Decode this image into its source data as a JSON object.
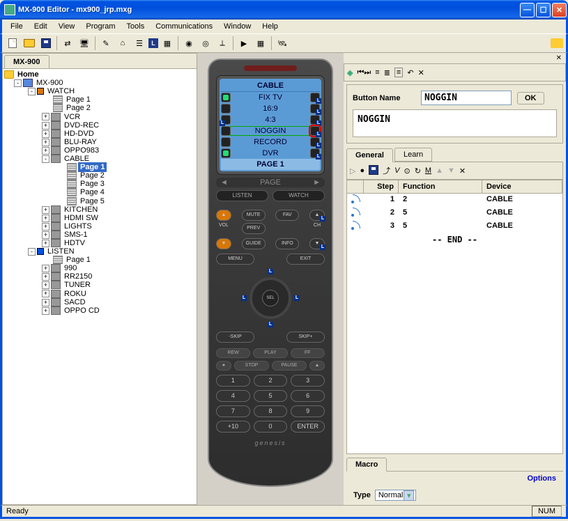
{
  "window": {
    "title": "MX-900 Editor - mx900_jrp.mxg"
  },
  "menu": [
    "File",
    "Edit",
    "View",
    "Program",
    "Tools",
    "Communications",
    "Window",
    "Help"
  ],
  "tree": {
    "tab": "MX-900",
    "root": "Home",
    "device": "MX-900",
    "watch": {
      "label": "WATCH",
      "pages": [
        "Page 1",
        "Page 2"
      ],
      "children": [
        "VCR",
        "DVD-REC",
        "HD-DVD",
        "BLU-RAY",
        "OPPO983"
      ],
      "cable": {
        "label": "CABLE",
        "pages": [
          "Page 1",
          "Page 2",
          "Page 3",
          "Page 4",
          "Page 5"
        ],
        "selected": 0
      },
      "rest": [
        "KITCHEN",
        "HDMI SW",
        "LIGHTS",
        "SMS-1",
        "HDTV"
      ]
    },
    "listen": {
      "label": "LISTEN",
      "pages": [
        "Page 1"
      ],
      "children": [
        "990",
        "RR2150",
        "TUNER",
        "ROKU",
        "SACD",
        "OPPO CD"
      ]
    }
  },
  "remote": {
    "lcd_title": "CABLE",
    "lcd_rows": [
      "FIX TV",
      "16:9",
      "4:3",
      "NOGGIN",
      "RECORD",
      "DVR"
    ],
    "lcd_selected": 3,
    "lcd_footer": "PAGE 1",
    "page_label": "PAGE",
    "listen": "LISTEN",
    "watch": "WATCH",
    "logo": "genesis",
    "nums": [
      "1",
      "2",
      "3",
      "4",
      "5",
      "6",
      "7",
      "8",
      "9",
      "+10",
      "0",
      "ENTER"
    ],
    "hard": {
      "mute": "MUTE",
      "vol": "VOL",
      "ch": "CH",
      "fav": "FAV",
      "prev": "PREV",
      "guide": "GUIDE",
      "info": "INFO",
      "menu": "MENU",
      "exit": "EXIT",
      "sel": "SEL",
      "skipm": "-SKIP",
      "skipp": "SKIP+",
      "rew": "REW",
      "play": "PLAY",
      "ff": "FF",
      "stop": "STOP",
      "pause": "PAUSE"
    }
  },
  "props": {
    "button_name_label": "Button Name",
    "button_name_value": "NOGGIN",
    "ok": "OK",
    "display_text": "NOGGIN",
    "tabs": [
      "General",
      "Learn"
    ],
    "active_tab": 0
  },
  "macro": {
    "columns": [
      "Step",
      "Function",
      "Device"
    ],
    "rows": [
      {
        "step": "1",
        "func": "2",
        "device": "CABLE"
      },
      {
        "step": "2",
        "func": "5",
        "device": "CABLE"
      },
      {
        "step": "3",
        "func": "5",
        "device": "CABLE"
      }
    ],
    "end": "-- END --",
    "tab": "Macro",
    "options": "Options",
    "type_label": "Type",
    "type_value": "Normal"
  },
  "status": {
    "ready": "Ready",
    "num": "NUM"
  }
}
